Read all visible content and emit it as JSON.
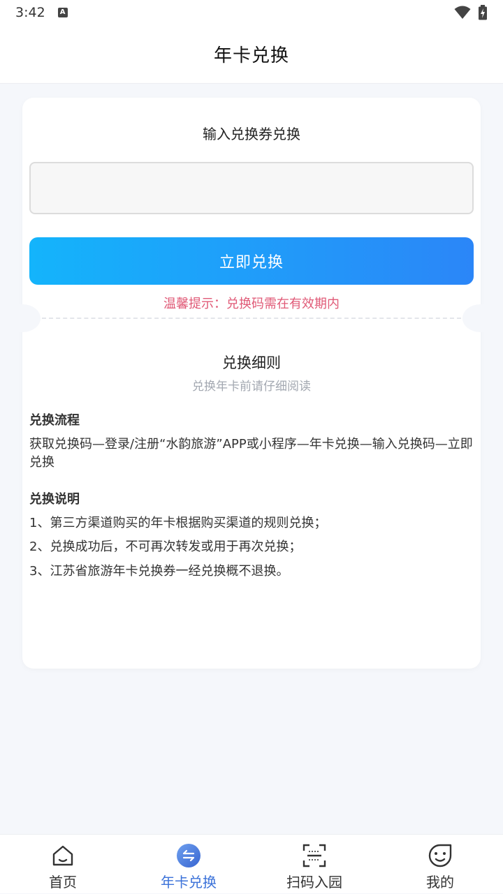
{
  "status_bar": {
    "time": "3:42",
    "indicator": "A"
  },
  "header": {
    "title": "年卡兑换"
  },
  "redeem": {
    "title": "输入兑换券兑换",
    "input_value": "",
    "input_placeholder": "",
    "button_label": "立即兑换",
    "tip": "温馨提示：兑换码需在有效期内"
  },
  "rules": {
    "title": "兑换细则",
    "subtitle": "兑换年卡前请仔细阅读",
    "process_title": "兑换流程",
    "process_text": "获取兑换码—登录/注册“水韵旅游”APP或小程序—年卡兑换—输入兑换码—立即兑换",
    "notes_title": "兑换说明",
    "notes": [
      "1、第三方渠道购买的年卡根据购买渠道的规则兑换；",
      "2、兑换成功后，不可再次转发或用于再次兑换；",
      "3、江苏省旅游年卡兑换券一经兑换概不退换。"
    ]
  },
  "tabbar": {
    "items": [
      {
        "label": "首页",
        "icon": "home-icon"
      },
      {
        "label": "年卡兑换",
        "icon": "exchange-icon",
        "active": true
      },
      {
        "label": "扫码入园",
        "icon": "scan-icon"
      },
      {
        "label": "我的",
        "icon": "profile-face-icon"
      }
    ]
  },
  "colors": {
    "accent": "#3b72d9",
    "button_gradient_start": "#14b4fb",
    "button_gradient_end": "#2b86f8",
    "tip": "#e05a77",
    "background": "#f5f7fb"
  }
}
